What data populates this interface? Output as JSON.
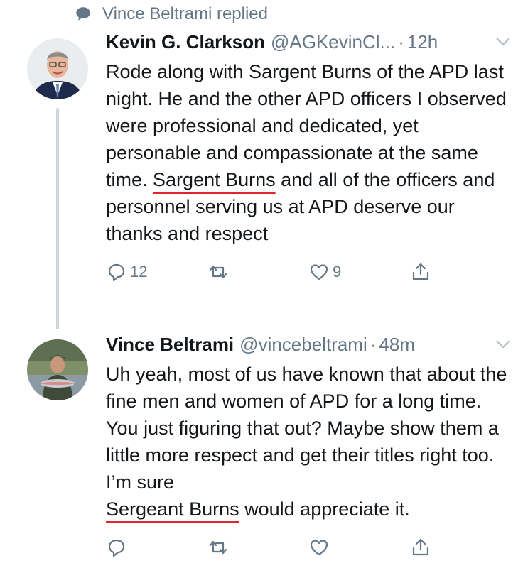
{
  "context": {
    "label": "Vince Beltrami replied"
  },
  "tweets": [
    {
      "name": "Kevin G. Clarkson",
      "handle": "@AGKevinCl...",
      "sep": "·",
      "time": "12h",
      "text_pre": "Rode along with Sargent Burns of the APD last night.  He and the other APD officers I observed were professional and dedicated, yet personable and compassionate at the same time.",
      "text_highlight": "Sargent Burns",
      "text_post": " and all of the officers and personnel serving us at APD deserve our thanks and respect",
      "replies": "12",
      "retweets": "",
      "likes": "9"
    },
    {
      "name": "Vince Beltrami",
      "handle": "@vincebeltrami",
      "sep": "·",
      "time": "48m",
      "text_pre": "Uh yeah, most of us have known that about the fine men and women of APD for a long time. You just figuring that out? Maybe show them a little more respect and get their titles right too. I’m sure",
      "text_highlight": "Sergeant Burns",
      "text_post": " would appreciate it.",
      "replies": "",
      "retweets": "",
      "likes": ""
    }
  ],
  "colors": {
    "accent_underline": "#e0242f",
    "muted": "#657786",
    "thread_line": "#ccd6dd"
  },
  "icons": [
    "reply-icon",
    "retweet-icon",
    "like-icon",
    "share-icon",
    "chevron-down-icon",
    "speech-bubble-icon"
  ]
}
